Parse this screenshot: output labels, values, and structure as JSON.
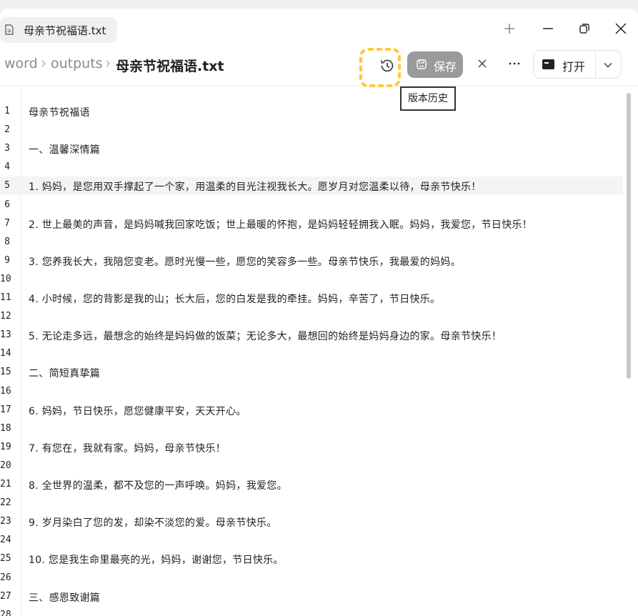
{
  "tab": {
    "title": "母亲节祝福语.txt"
  },
  "breadcrumb": {
    "items": [
      "word",
      "outputs"
    ],
    "current": "母亲节祝福语.txt"
  },
  "toolbar": {
    "save_label": "保存",
    "open_label": "打开",
    "tooltip": "版本历史"
  },
  "editor": {
    "active_line": 5,
    "lines": [
      "母亲节祝福语",
      "",
      "一、温馨深情篇",
      "",
      "1. 妈妈，是您用双手撑起了一个家，用温柔的目光注视我长大。愿岁月对您温柔以待，母亲节快乐！",
      "",
      "2. 世上最美的声音，是妈妈喊我回家吃饭；世上最暖的怀抱，是妈妈轻轻拥我入眠。妈妈，我爱您，节日快乐！",
      "",
      "3. 您养我长大，我陪您变老。愿时光慢一些，愿您的笑容多一些。母亲节快乐，我最爱的妈妈。",
      "",
      "4. 小时候，您的背影是我的山；长大后，您的白发是我的牵挂。妈妈，辛苦了，节日快乐。",
      "",
      "5. 无论走多远，最想念的始终是妈妈做的饭菜；无论多大，最想回的始终是妈妈身边的家。母亲节快乐！",
      "",
      "二、简短真挚篇",
      "",
      "6. 妈妈，节日快乐，愿您健康平安，天天开心。",
      "",
      "7. 有您在，我就有家。妈妈，母亲节快乐！",
      "",
      "8. 全世界的温柔，都不及您的一声呼唤。妈妈，我爱您。",
      "",
      "9. 岁月染白了您的发，却染不淡您的爱。母亲节快乐。",
      "",
      "10. 您是我生命里最亮的光，妈妈，谢谢您，节日快乐。",
      "",
      "三、感恩致谢篇",
      ""
    ]
  },
  "colors": {
    "save_bg": "#9a9a9a",
    "focus_ring": "#ffc83d",
    "active_line_bg": "#f4f4f4"
  }
}
